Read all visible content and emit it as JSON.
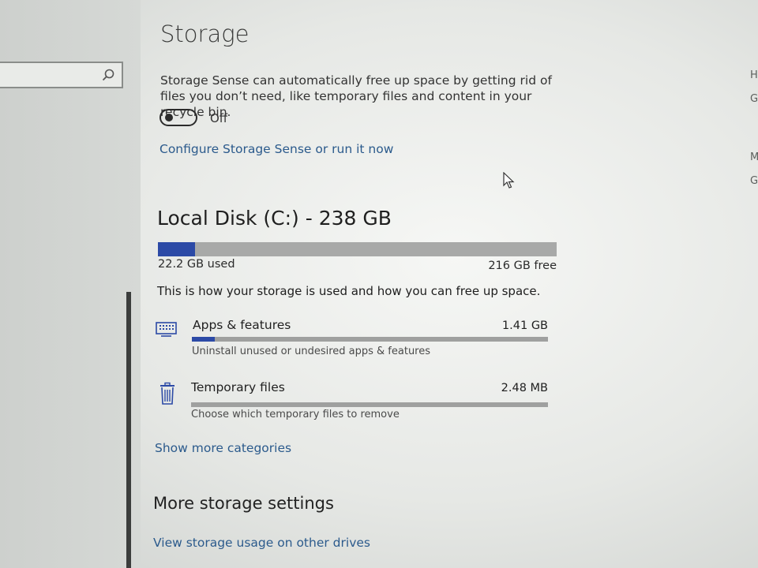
{
  "left_pane": {
    "search_icon": "search-icon"
  },
  "storage": {
    "title": "Storage",
    "description": "Storage Sense can automatically free up space by getting rid of files you don’t need, like temporary files and content in your recycle bin.",
    "toggle": {
      "state": "off",
      "label": "Off"
    },
    "configure_link": "Configure Storage Sense or run it now"
  },
  "disk": {
    "title": "Local Disk (C:) - 238 GB",
    "used_fraction": 0.093,
    "used_label": "22.2 GB used",
    "free_label": "216 GB free",
    "intro": "This is how your storage is used and how you can free up space."
  },
  "categories": [
    {
      "icon": "apps-features-icon",
      "name": "Apps & features",
      "size": "1.41 GB",
      "fraction": 0.065,
      "subtitle": "Uninstall unused or undesired apps & features"
    },
    {
      "icon": "trash-icon",
      "name": "Temporary files",
      "size": "2.48 MB",
      "fraction": 0.0,
      "subtitle": "Choose which temporary files to remove"
    }
  ],
  "show_more_link": "Show more categories",
  "more_settings": {
    "heading": "More storage settings",
    "link": "View storage usage on other drives"
  },
  "right_edge_letters": [
    "H",
    "G",
    "M",
    "G"
  ],
  "colors": {
    "accent": "#2c4aa6",
    "link": "#2b5a8c"
  }
}
